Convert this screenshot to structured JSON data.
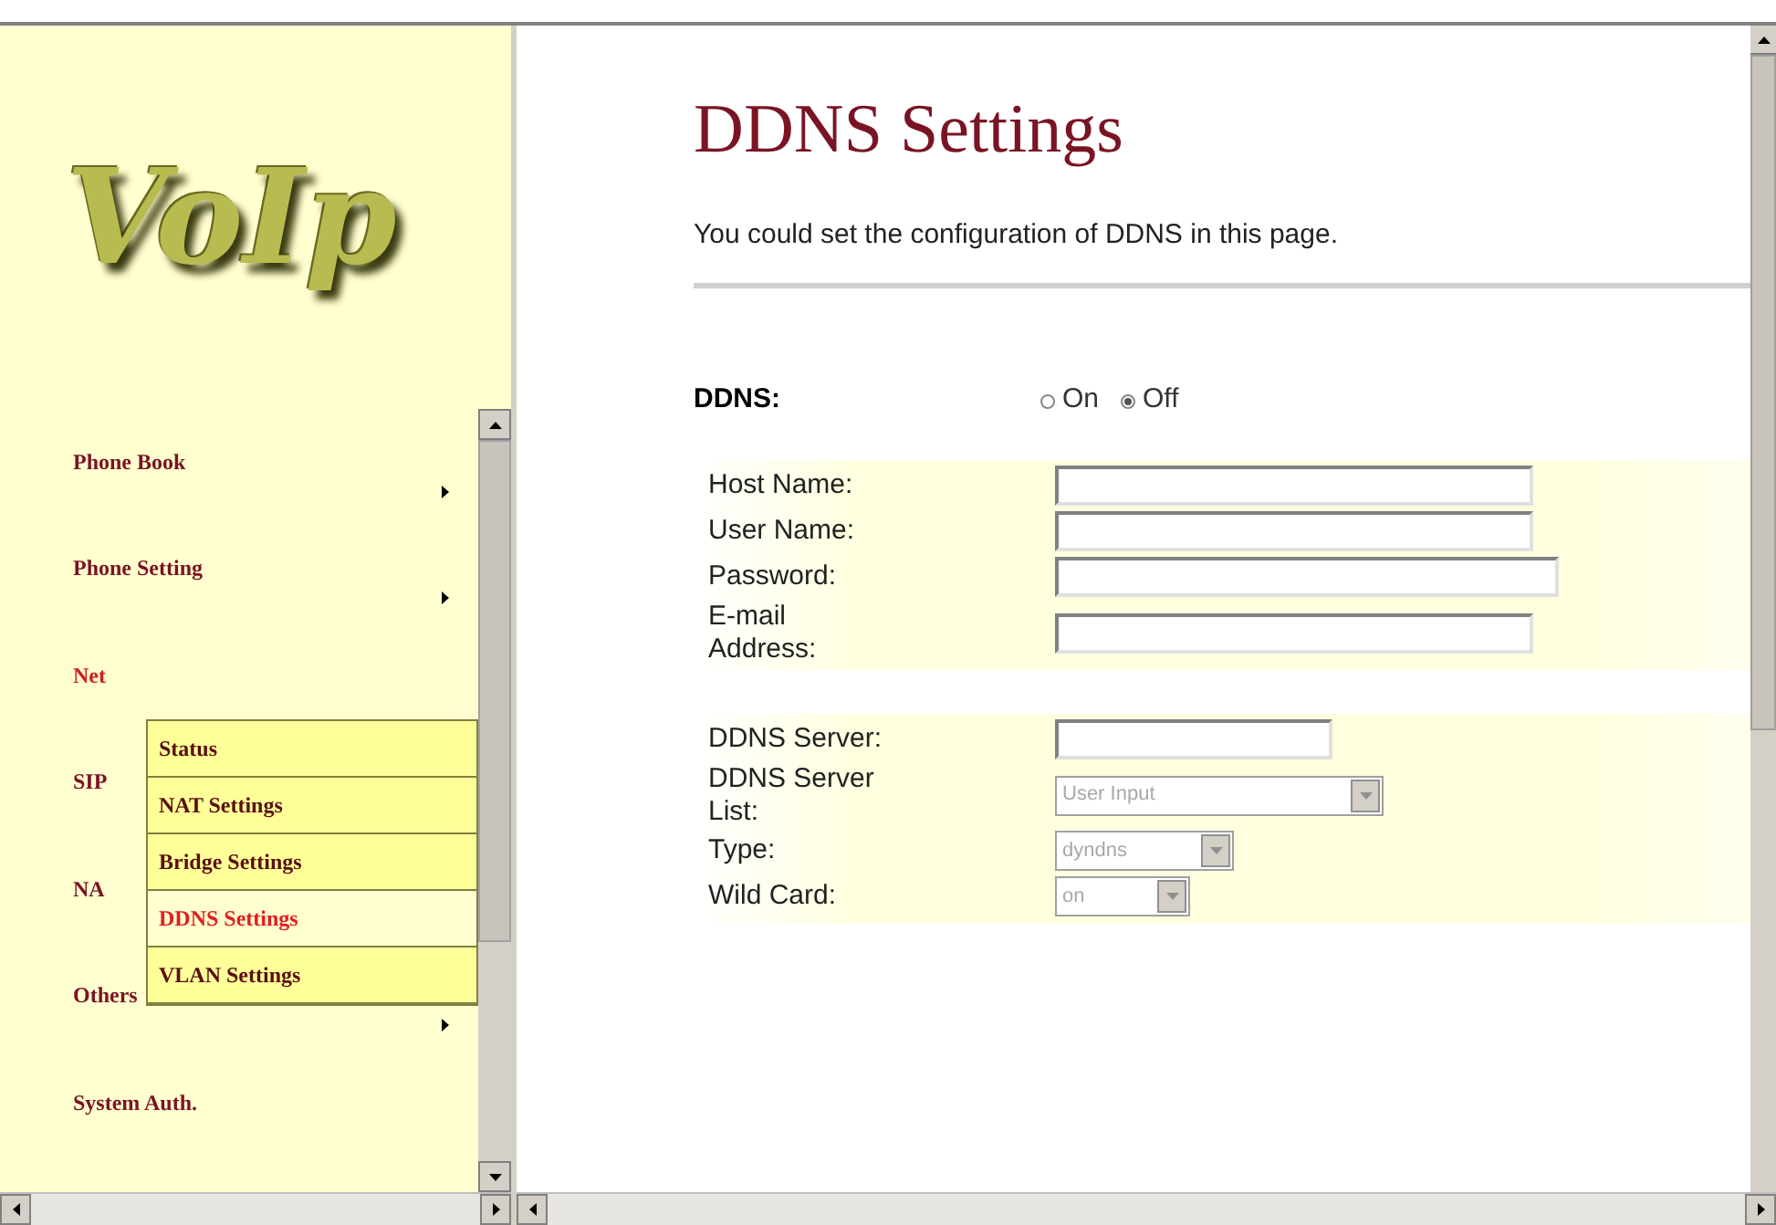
{
  "logo": {
    "text": "VoIp"
  },
  "menu": [
    {
      "label": "Phone Book",
      "has_submenu": true,
      "selected": false
    },
    {
      "label": "Phone Setting",
      "has_submenu": true,
      "selected": false
    },
    {
      "label": "Net",
      "has_submenu": false,
      "selected": true
    },
    {
      "label": "SIP",
      "has_submenu": false,
      "selected": false
    },
    {
      "label": "NA",
      "has_submenu": false,
      "selected": false
    },
    {
      "label": "Others",
      "has_submenu": true,
      "selected": false
    },
    {
      "label": "System Auth.",
      "has_submenu": false,
      "selected": false
    }
  ],
  "submenu": [
    {
      "label": "Status",
      "selected": false
    },
    {
      "label": "NAT Settings",
      "selected": false
    },
    {
      "label": "Bridge Settings",
      "selected": false
    },
    {
      "label": "DDNS Settings",
      "selected": true
    },
    {
      "label": "VLAN Settings",
      "selected": false
    }
  ],
  "page": {
    "title": "DDNS Settings",
    "description": "You could set the configuration of DDNS in this page."
  },
  "ddns": {
    "label": "DDNS:",
    "options": [
      {
        "label": "On",
        "selected": false
      },
      {
        "label": "Off",
        "selected": true
      }
    ]
  },
  "groups": [
    [
      {
        "kind": "text",
        "label": "Host Name:"
      },
      {
        "kind": "text",
        "label": "User Name:"
      },
      {
        "kind": "text",
        "label": "Password:"
      },
      {
        "kind": "text",
        "label": "E-mail Address:"
      }
    ],
    [
      {
        "kind": "text",
        "label": "DDNS Server:"
      },
      {
        "kind": "select",
        "label": "DDNS Server List:",
        "value": "User Input",
        "disabled": true
      },
      {
        "kind": "select",
        "label": "Type:",
        "value": "dyndns",
        "disabled": true
      },
      {
        "kind": "select",
        "label": "Wild Card:",
        "value": "on",
        "disabled": true
      }
    ]
  ]
}
